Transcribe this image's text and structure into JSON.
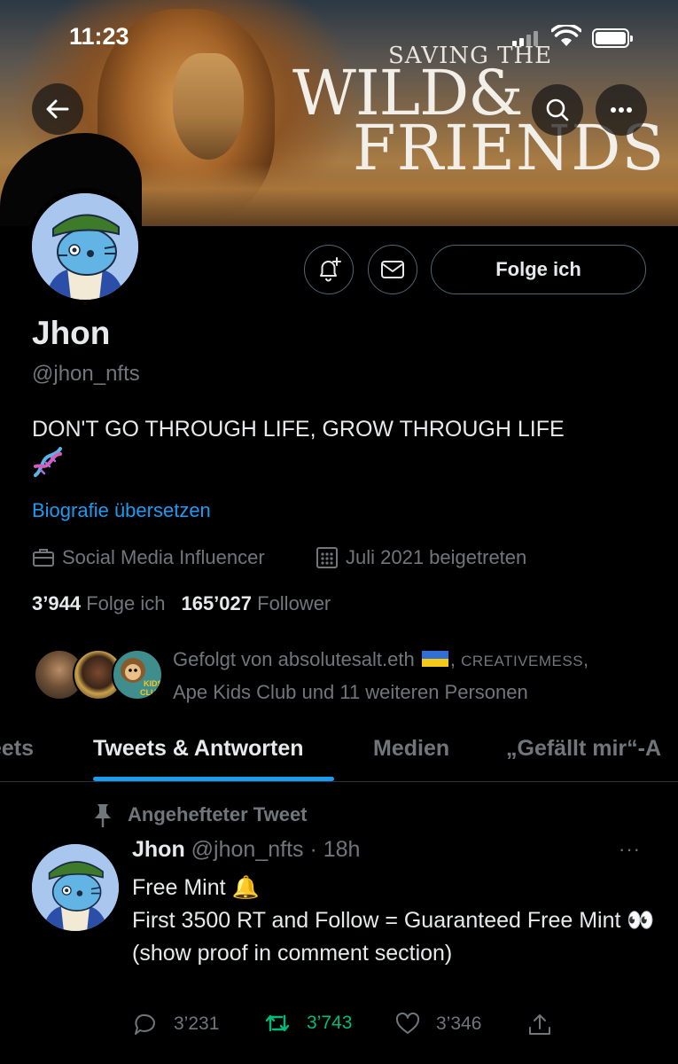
{
  "status_bar": {
    "time": "11:23"
  },
  "banner": {
    "line1": "SAVING THE",
    "line2": "WILD&",
    "line3": "FRIENDS"
  },
  "profile": {
    "follow_button": "Folge ich",
    "name": "Jhon",
    "handle": "@jhon_nfts",
    "bio": "DON'T GO THROUGH LIFE, GROW THROUGH LIFE",
    "translate_link": "Biografie übersetzen",
    "category": "Social Media Influencer",
    "joined": "Juli 2021 beigetreten",
    "following_count": "3’944",
    "following_label": "Folge ich",
    "followers_count": "165’027",
    "followers_label": "Follower",
    "followed_by_prefix": "Gefolgt von absolutesalt.eth",
    "followed_by_caps": "CREATIVEMESS",
    "followed_by_rest": "Ape Kids Club und 11 weiteren Personen",
    "ape_badge_line1": "KIDS",
    "ape_badge_line2": "CLUB"
  },
  "tabs": [
    {
      "label": "eets"
    },
    {
      "label": "Tweets & Antworten"
    },
    {
      "label": "Medien"
    },
    {
      "label": "„Gefällt mir“-A"
    }
  ],
  "tweet": {
    "pinned_label": "Angehefteter Tweet",
    "author": "Jhon",
    "handle_time": "@jhon_nfts · 18h",
    "more": "···",
    "line1": "Free Mint 🔔",
    "line2": "First 3500 RT and Follow  = Guaranteed Free Mint 👀",
    "line3": "(show proof in comment section)",
    "replies": "3’231",
    "retweets": "3’743",
    "likes": "3’346"
  },
  "colors": {
    "accent": "#1d9bf0",
    "retweet": "#00ba7c",
    "secondary_text": "#71767b",
    "background": "#000000"
  }
}
